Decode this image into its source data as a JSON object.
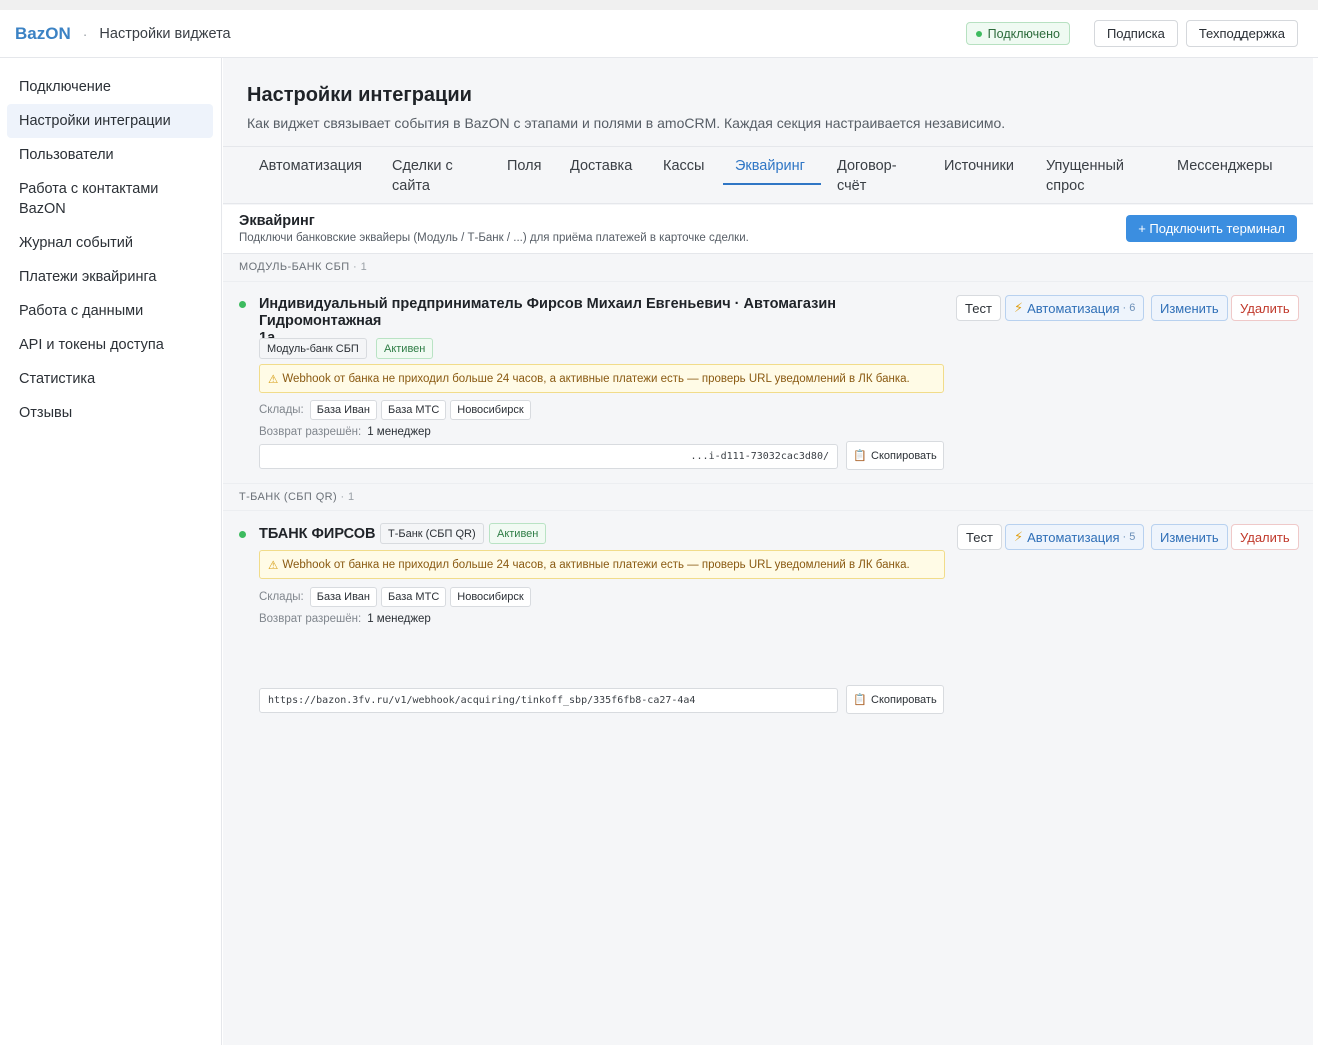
{
  "header": {
    "brand": "BazON",
    "separator": "·",
    "title": "Настройки виджета",
    "status": "Подключено",
    "subscription_btn": "Подписка",
    "support_btn": "Техподдержка"
  },
  "sidebar": {
    "items": [
      {
        "label": "Подключение"
      },
      {
        "label": "Настройки интеграции",
        "active": true
      },
      {
        "label": "Пользователи"
      },
      {
        "label": "Работа с контактами BazON"
      },
      {
        "label": "Журнал событий"
      },
      {
        "label": "Платежи эквайринга"
      },
      {
        "label": "Работа с данными"
      },
      {
        "label": "API и токены доступа"
      },
      {
        "label": "Статистика"
      },
      {
        "label": "Отзывы"
      }
    ]
  },
  "page": {
    "title": "Настройки интеграции",
    "subtitle": "Как виджет связывает события в BazON с этапами и полями в amoCRM. Каждая секция настраивается независимо."
  },
  "tabs": [
    {
      "label": "Автоматизация"
    },
    {
      "label": "Сделки с сайта"
    },
    {
      "label": "Поля"
    },
    {
      "label": "Доставка"
    },
    {
      "label": "Кассы"
    },
    {
      "label": "Эквайринг",
      "active": true
    },
    {
      "label": "Договор-счёт"
    },
    {
      "label": "Источники"
    },
    {
      "label": "Упущенный спрос"
    },
    {
      "label": "Мессенджеры"
    }
  ],
  "section": {
    "title": "Эквайринг",
    "subtitle": "Подключи банковские эквайеры (Модуль / Т-Банк / ...) для приёма платежей в карточке сделки.",
    "connect_btn": "+ Подключить терминал"
  },
  "groups": [
    {
      "label": "МОДУЛЬ-БАНК СБП",
      "count": "· 1",
      "terminal": {
        "title_line1": "Индивидуальный предприниматель Фирсов Михаил Евгеньевич · Автомагазин Гидромонтажная",
        "title_line2": "1а",
        "provider": "Модуль-банк СБП",
        "status": "Активен",
        "warning": "Webhook от банка не приходил больше 24 часов, а активные платежи есть — проверь URL уведомлений в ЛК банка.",
        "warehouses_label": "Склады:",
        "warehouses": [
          "База Иван",
          "База МТС",
          "Новосибирск"
        ],
        "refund_label": "Возврат разрешён:",
        "refund_value": "1 менеджер",
        "webhook_url": "                                                                      ...i-d111-73032cac3d80/",
        "copy_label": "Скопировать",
        "actions": {
          "test": "Тест",
          "automation": "Автоматизация",
          "automation_count": "· 6",
          "edit": "Изменить",
          "delete": "Удалить"
        }
      }
    },
    {
      "label": "Т-БАНК (СБП QR)",
      "count": "· 1",
      "terminal": {
        "title_line1": "ТБАНК ФИРСОВ",
        "provider": "Т-Банк (СБП QR)",
        "status": "Активен",
        "warning": "Webhook от банка не приходил больше 24 часов, а активные платежи есть — проверь URL уведомлений в ЛК банка.",
        "warehouses_label": "Склады:",
        "warehouses": [
          "База Иван",
          "База МТС",
          "Новосибирск"
        ],
        "refund_label": "Возврат разрешён:",
        "refund_value": "1 менеджер",
        "webhook_url": "https://bazon.3fv.ru/v1/webhook/acquiring/tinkoff_sbp/335f6fb8-ca27-4a4",
        "copy_label": "Скопировать",
        "actions": {
          "test": "Тест",
          "automation": "Автоматизация",
          "automation_count": "· 5",
          "edit": "Изменить",
          "delete": "Удалить"
        }
      }
    }
  ],
  "icons": {
    "warning": "warning-icon",
    "bolt": "bolt-icon",
    "clipboard": "clipboard-icon",
    "status_dot": "status-dot"
  },
  "colors": {
    "accent": "#2f76c5",
    "brand": "#3b82c4",
    "primary_btn": "#3b8ee0",
    "active_dot": "#3dbb5f",
    "delete": "#c0392b"
  }
}
